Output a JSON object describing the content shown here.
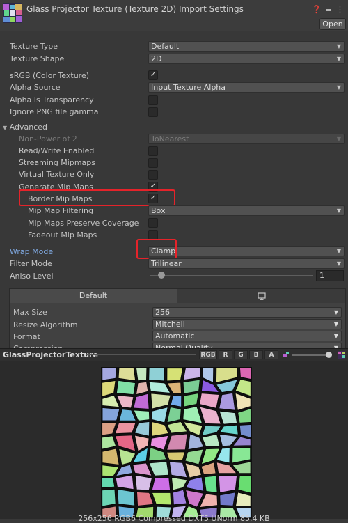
{
  "header": {
    "title": "Glass Projector Texture (Texture 2D) Import Settings",
    "open_label": "Open",
    "icons": [
      "help-icon",
      "preset-icon",
      "more-icon"
    ]
  },
  "settings": {
    "texture_type": {
      "label": "Texture Type",
      "value": "Default"
    },
    "texture_shape": {
      "label": "Texture Shape",
      "value": "2D"
    },
    "srgb": {
      "label": "sRGB (Color Texture)",
      "checked": true
    },
    "alpha_source": {
      "label": "Alpha Source",
      "value": "Input Texture Alpha"
    },
    "alpha_transparency": {
      "label": "Alpha Is Transparency",
      "checked": false
    },
    "ignore_png_gamma": {
      "label": "Ignore PNG file gamma",
      "checked": false
    },
    "advanced": {
      "label": "Advanced"
    },
    "non_power_of_2": {
      "label": "Non-Power of 2",
      "value": "ToNearest"
    },
    "read_write": {
      "label": "Read/Write Enabled",
      "checked": false
    },
    "streaming_mipmaps": {
      "label": "Streaming Mipmaps",
      "checked": false
    },
    "virtual_texture": {
      "label": "Virtual Texture Only",
      "checked": false
    },
    "generate_mip_maps": {
      "label": "Generate Mip Maps",
      "checked": true
    },
    "border_mip_maps": {
      "label": "Border Mip Maps",
      "checked": true
    },
    "mip_map_filtering": {
      "label": "Mip Map Filtering",
      "value": "Box"
    },
    "mip_preserve_coverage": {
      "label": "Mip Maps Preserve Coverage",
      "checked": false
    },
    "fadeout_mip_maps": {
      "label": "Fadeout Mip Maps",
      "checked": false
    },
    "wrap_mode": {
      "label": "Wrap Mode",
      "value": "Clamp"
    },
    "filter_mode": {
      "label": "Filter Mode",
      "value": "Trilinear"
    },
    "aniso_level": {
      "label": "Aniso Level",
      "value": "1"
    }
  },
  "platform": {
    "tabs": [
      {
        "label": "Default"
      },
      {
        "label": "",
        "icon": "monitor-icon"
      }
    ],
    "max_size": {
      "label": "Max Size",
      "value": "256"
    },
    "resize_algorithm": {
      "label": "Resize Algorithm",
      "value": "Mitchell"
    },
    "format": {
      "label": "Format",
      "value": "Automatic"
    },
    "compression": {
      "label": "Compression",
      "value": "Normal Quality"
    }
  },
  "preview": {
    "name": "GlassProjectorTexture",
    "channels": [
      "RGB",
      "R",
      "G",
      "B",
      "A"
    ],
    "info": "256x256  RGB6 Compressed DXT5 UNorm  85.4 KB"
  },
  "colors": {
    "highlight": "#e5232a",
    "accent_label": "#7fa8e0"
  }
}
